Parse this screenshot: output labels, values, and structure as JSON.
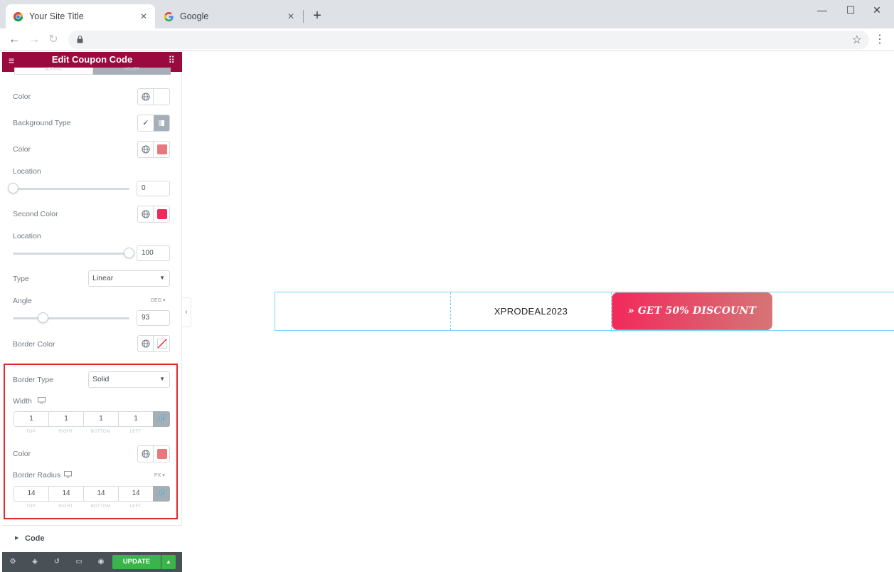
{
  "browser": {
    "tabs": [
      {
        "title": "Your Site Title",
        "active": true
      },
      {
        "title": "Google",
        "active": false
      }
    ],
    "close_glyph": "✕",
    "new_tab_glyph": "+",
    "window_controls": [
      "—",
      "☐",
      "✕"
    ],
    "nav": {
      "back": "←",
      "forward": "→",
      "reload": "↻"
    },
    "star_glyph": "☆",
    "menu_glyph": "⋮"
  },
  "panel": {
    "title": "Edit Coupon Code",
    "menu_glyph": "≡",
    "grid_glyph": "⠿",
    "state_tabs": {
      "normal": "NORMAL",
      "hover": "HOVER"
    },
    "controls": {
      "color_label": "Color",
      "background_type_label": "Background Type",
      "bg_color_label": "Color",
      "bg_color_value": "#e8787e",
      "location_label": "Location",
      "location_value": "0",
      "second_color_label": "Second Color",
      "second_color_value": "#f0285a",
      "location2_label": "Location",
      "location2_value": "100",
      "type_label": "Type",
      "type_value": "Linear",
      "angle_label": "Angle",
      "angle_unit": "DEG ▾",
      "angle_value": "93",
      "border_color_label": "Border Color",
      "border_type_label": "Border Type",
      "border_type_value": "Solid",
      "width_label": "Width",
      "width_values": [
        "1",
        "1",
        "1",
        "1"
      ],
      "side_labels": [
        "TOP",
        "RIGHT",
        "BOTTOM",
        "LEFT"
      ],
      "border_color2_label": "Color",
      "border_color2_value": "#e8787e",
      "radius_label": "Border Radius",
      "radius_unit": "PX ▾",
      "radius_values": [
        "14",
        "14",
        "14",
        "14"
      ]
    },
    "sections": {
      "code": "Code"
    },
    "footer": {
      "update": "UPDATE"
    }
  },
  "canvas": {
    "coupon_code": "XPRODEAL2023",
    "button_text": "» GET 50% DISCOUNT"
  },
  "colors": {
    "panel_header": "#9b0a3f",
    "update_green": "#39b54a",
    "highlight": "#e5252c",
    "gradient_start": "#f2295b",
    "gradient_end": "#d57577"
  }
}
